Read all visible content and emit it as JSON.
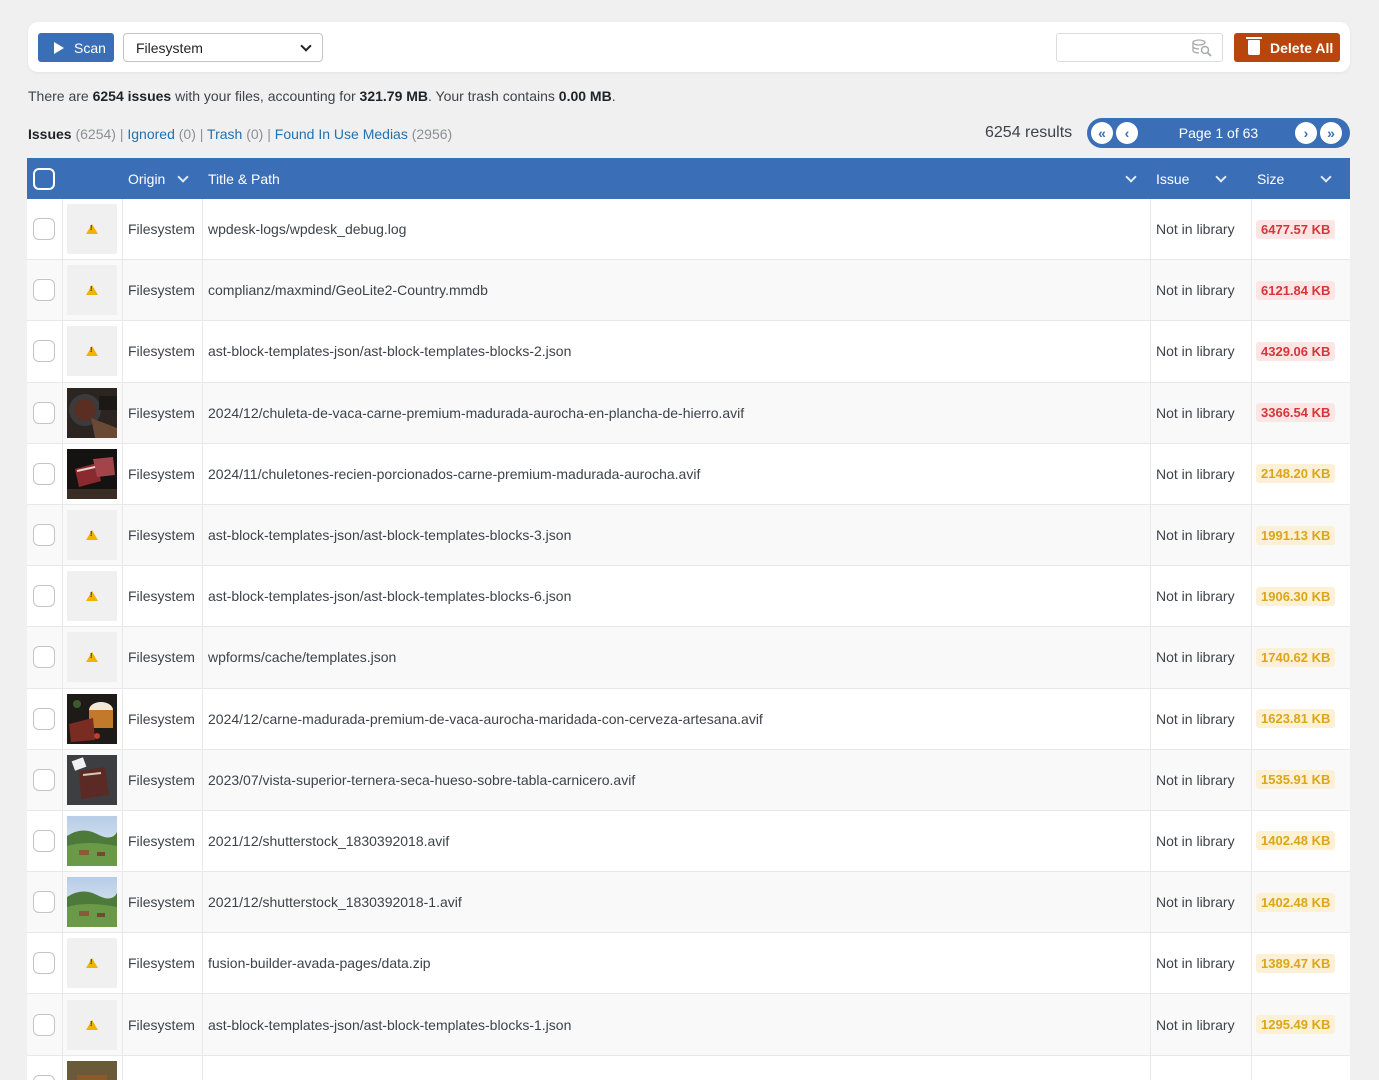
{
  "toolbar": {
    "scan_label": "Scan",
    "source_select": "Filesystem",
    "search_placeholder": "",
    "delete_all_label": "Delete All"
  },
  "summary": {
    "prefix": "There are ",
    "issues": "6254 issues",
    "middle": " with your files, accounting for ",
    "size": "321.79 MB",
    "trash_text": ". Your trash contains ",
    "trash_size": "0.00 MB",
    "suffix": "."
  },
  "filters": [
    {
      "label": "Issues",
      "count": "(6254)"
    },
    {
      "label": "Ignored",
      "count": "(0)"
    },
    {
      "label": "Trash",
      "count": "(0)"
    },
    {
      "label": "Found In Use Medias",
      "count": "(2956)"
    }
  ],
  "results_text": "6254 results",
  "pager": {
    "label": "Page 1 of 63"
  },
  "columns": {
    "origin": "Origin",
    "title": "Title & Path",
    "issue": "Issue",
    "size": "Size"
  },
  "rows": [
    {
      "thumb": "warning",
      "origin": "Filesystem",
      "path": "wpdesk-logs/wpdesk_debug.log",
      "issue": "Not in library",
      "size": "6477.57 KB",
      "level": "red"
    },
    {
      "thumb": "warning",
      "origin": "Filesystem",
      "path": "complianz/maxmind/GeoLite2-Country.mmdb",
      "issue": "Not in library",
      "size": "6121.84 KB",
      "level": "red"
    },
    {
      "thumb": "warning",
      "origin": "Filesystem",
      "path": "ast-block-templates-json/ast-block-templates-blocks-2.json",
      "issue": "Not in library",
      "size": "4329.06 KB",
      "level": "red"
    },
    {
      "thumb": "meat-pan",
      "origin": "Filesystem",
      "path": "2024/12/chuleta-de-vaca-carne-premium-madurada-aurocha-en-plancha-de-hierro.avif",
      "issue": "Not in library",
      "size": "3366.54 KB",
      "level": "red"
    },
    {
      "thumb": "meat-cut",
      "origin": "Filesystem",
      "path": "2024/11/chuletones-recien-porcionados-carne-premium-madurada-aurocha.avif",
      "issue": "Not in library",
      "size": "2148.20 KB",
      "level": "orange"
    },
    {
      "thumb": "warning",
      "origin": "Filesystem",
      "path": "ast-block-templates-json/ast-block-templates-blocks-3.json",
      "issue": "Not in library",
      "size": "1991.13 KB",
      "level": "orange"
    },
    {
      "thumb": "warning",
      "origin": "Filesystem",
      "path": "ast-block-templates-json/ast-block-templates-blocks-6.json",
      "issue": "Not in library",
      "size": "1906.30 KB",
      "level": "orange"
    },
    {
      "thumb": "warning",
      "origin": "Filesystem",
      "path": "wpforms/cache/templates.json",
      "issue": "Not in library",
      "size": "1740.62 KB",
      "level": "orange"
    },
    {
      "thumb": "meat-beer",
      "origin": "Filesystem",
      "path": "2024/12/carne-madurada-premium-de-vaca-aurocha-maridada-con-cerveza-artesana.avif",
      "issue": "Not in library",
      "size": "1623.81 KB",
      "level": "orange"
    },
    {
      "thumb": "meat-board",
      "origin": "Filesystem",
      "path": "2023/07/vista-superior-ternera-seca-hueso-sobre-tabla-carnicero.avif",
      "issue": "Not in library",
      "size": "1535.91 KB",
      "level": "orange"
    },
    {
      "thumb": "field",
      "origin": "Filesystem",
      "path": "2021/12/shutterstock_1830392018.avif",
      "issue": "Not in library",
      "size": "1402.48 KB",
      "level": "orange"
    },
    {
      "thumb": "field",
      "origin": "Filesystem",
      "path": "2021/12/shutterstock_1830392018-1.avif",
      "issue": "Not in library",
      "size": "1402.48 KB",
      "level": "orange"
    },
    {
      "thumb": "warning",
      "origin": "Filesystem",
      "path": "fusion-builder-avada-pages/data.zip",
      "issue": "Not in library",
      "size": "1389.47 KB",
      "level": "orange"
    },
    {
      "thumb": "warning",
      "origin": "Filesystem",
      "path": "ast-block-templates-json/ast-block-templates-blocks-1.json",
      "issue": "Not in library",
      "size": "1295.49 KB",
      "level": "orange"
    },
    {
      "thumb": "cow",
      "origin": "",
      "path": "",
      "issue": "",
      "size": "",
      "level": "orange"
    }
  ]
}
